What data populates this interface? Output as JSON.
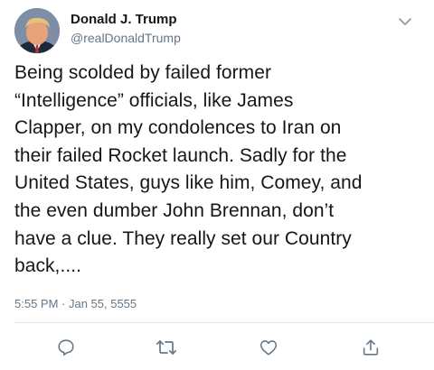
{
  "tweet": {
    "author": {
      "display_name": "Donald J. Trump",
      "handle": "@realDonaldTrump"
    },
    "text_lines": [
      "Being scolded by failed former",
      "“Intelligence” officials, like James",
      "Clapper, on my condolences to Iran on",
      "their failed Rocket launch. Sadly for the",
      "United States, guys like him, Comey, and",
      "the even dumber John Brennan, don’t",
      "have a clue. They really set our Country",
      "back,...."
    ],
    "timestamp": "5:55 PM · Jan 55, 5555"
  },
  "icons": {
    "avatar": "avatar-photo",
    "caret": "chevron-down-icon",
    "reply": "reply-icon",
    "retweet": "retweet-icon",
    "like": "heart-icon",
    "share": "share-icon"
  },
  "colors": {
    "text": "#14171a",
    "secondary": "#657786",
    "divider": "#e1e8ed",
    "icon": "#657786"
  }
}
